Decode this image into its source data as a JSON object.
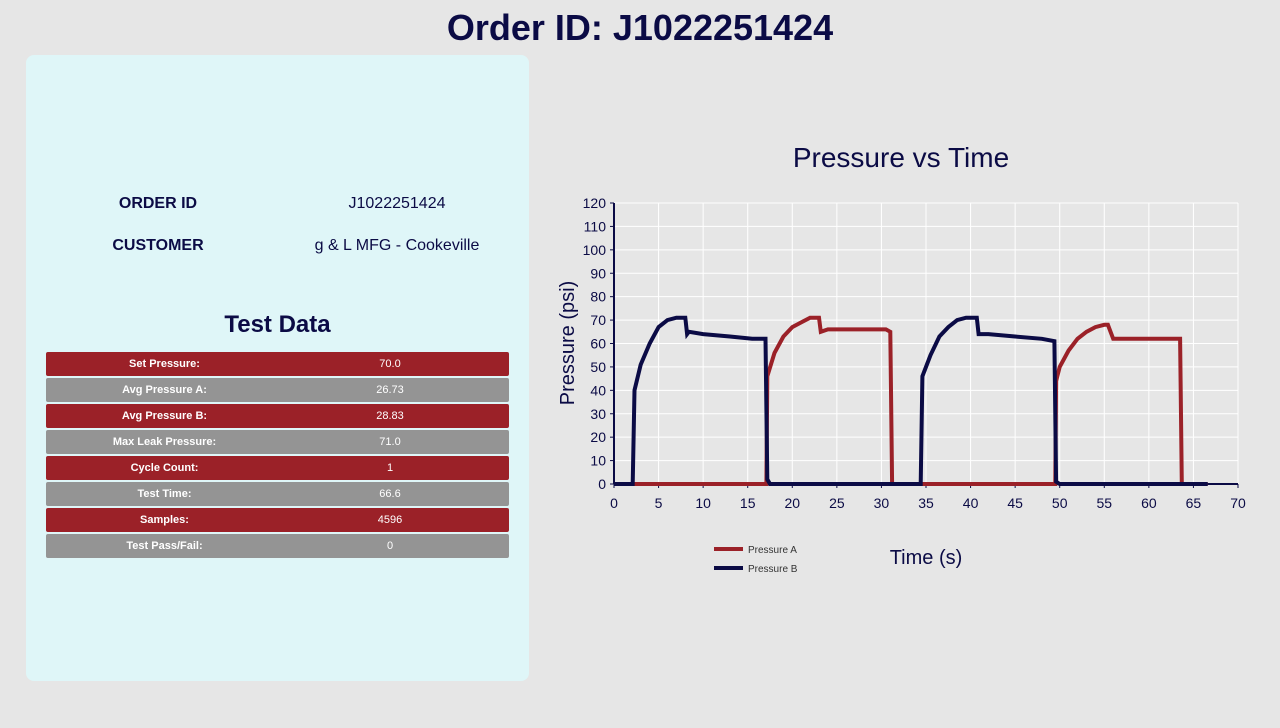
{
  "header": {
    "title": "Order ID: J1022251424"
  },
  "info": {
    "order_id_label": "ORDER ID",
    "order_id_value": "J1022251424",
    "customer_label": "CUSTOMER",
    "customer_value": "g & L MFG - Cookeville"
  },
  "test_data": {
    "title": "Test Data",
    "rows": [
      {
        "label": "Set Pressure:",
        "value": "70.0"
      },
      {
        "label": "Avg Pressure A:",
        "value": "26.73"
      },
      {
        "label": "Avg Pressure B:",
        "value": "28.83"
      },
      {
        "label": "Max Leak Pressure:",
        "value": "71.0"
      },
      {
        "label": "Cycle Count:",
        "value": "1"
      },
      {
        "label": "Test Time:",
        "value": "66.6"
      },
      {
        "label": "Samples:",
        "value": "4596"
      },
      {
        "label": "Test Pass/Fail:",
        "value": "0"
      }
    ]
  },
  "colors": {
    "primary_dark": "#0b0b45",
    "accent_red": "#9b2128",
    "row_grey": "#949494",
    "panel_bg": "#dff6f8"
  },
  "chart_data": {
    "type": "line",
    "title": "Pressure vs Time",
    "xlabel": "Time (s)",
    "ylabel": "Pressure (psi)",
    "xlim": [
      0,
      70
    ],
    "ylim": [
      0,
      120
    ],
    "xticks": [
      0,
      5,
      10,
      15,
      20,
      25,
      30,
      35,
      40,
      45,
      50,
      55,
      60,
      65,
      70
    ],
    "yticks": [
      0,
      10,
      20,
      30,
      40,
      50,
      60,
      70,
      80,
      90,
      100,
      110,
      120
    ],
    "grid": true,
    "legend": "bottom-left",
    "series": [
      {
        "name": "Pressure A",
        "color": "#9b2128",
        "x": [
          0,
          17.1,
          17.2,
          18,
          19,
          20,
          21,
          22,
          22.5,
          23.0,
          23.2,
          24,
          25,
          27,
          29,
          30.5,
          31.0,
          31.2,
          34,
          48,
          49.5,
          49.6,
          50,
          51,
          52,
          53,
          54,
          55,
          55.4,
          56,
          60,
          63.5,
          63.7,
          66.6
        ],
        "values": [
          0,
          0,
          46,
          56,
          63,
          67,
          69,
          71,
          71,
          71,
          65,
          66,
          66,
          66,
          66,
          66,
          65,
          0,
          0,
          0,
          0,
          44,
          50,
          57,
          62,
          65,
          67,
          68,
          68,
          62,
          62,
          62,
          0,
          0
        ]
      },
      {
        "name": "Pressure B",
        "color": "#0b0b45",
        "x": [
          0,
          2.1,
          2.3,
          3,
          4,
          5,
          6,
          7,
          8,
          8.2,
          8.4,
          10,
          13,
          15.5,
          17.0,
          17.2,
          17.5,
          20,
          34,
          34.4,
          34.6,
          35.5,
          36.5,
          37.5,
          38.5,
          39.5,
          40.5,
          40.7,
          40.9,
          42,
          45,
          48,
          49.4,
          49.6,
          50,
          55,
          60,
          66.6
        ],
        "values": [
          0,
          0,
          40,
          51,
          60,
          67,
          70,
          71,
          71,
          64,
          65,
          64,
          63,
          62,
          62,
          2,
          0,
          0,
          0,
          0,
          46,
          55,
          63,
          67,
          70,
          71,
          71,
          71,
          64,
          64,
          63,
          62,
          61,
          1,
          0,
          0,
          0,
          0
        ]
      }
    ]
  }
}
